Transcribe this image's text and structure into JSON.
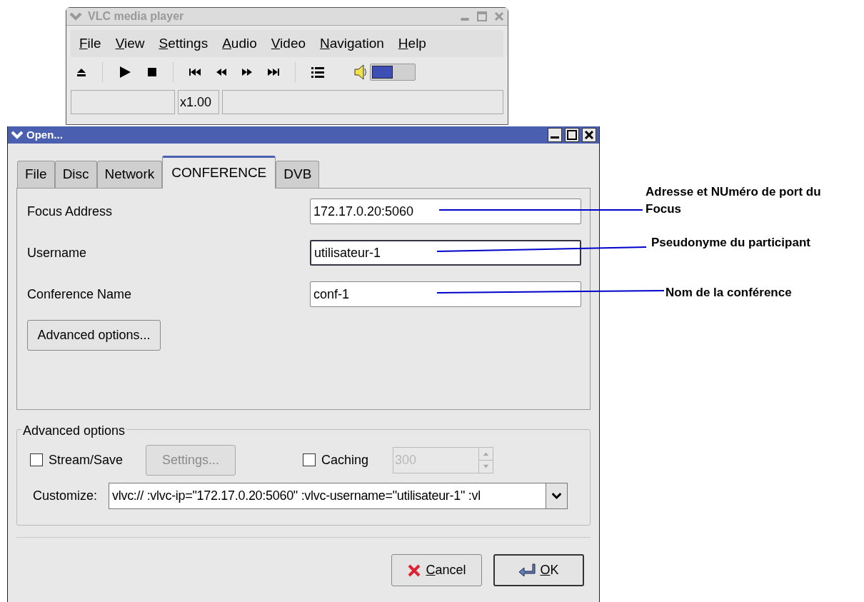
{
  "vlc_window": {
    "title": "VLC media player",
    "menu": [
      "File",
      "View",
      "Settings",
      "Audio",
      "Video",
      "Navigation",
      "Help"
    ],
    "volume": {
      "level": 0.5
    },
    "status_bar": {
      "speed": "x1.00"
    }
  },
  "open_dialog": {
    "title": "Open...",
    "tabs": [
      {
        "label": "File",
        "selected": false
      },
      {
        "label": "Disc",
        "selected": false
      },
      {
        "label": "Network",
        "selected": false
      },
      {
        "label": "CONFERENCE",
        "selected": true
      },
      {
        "label": "DVB",
        "selected": false
      }
    ],
    "fields": [
      {
        "label": "Focus Address",
        "value": "172.17.0.20:5060",
        "focused": false
      },
      {
        "label": "Username",
        "value": "utilisateur-1",
        "focused": true
      },
      {
        "label": "Conference Name",
        "value": "conf-1",
        "focused": false
      }
    ],
    "advanced_button": "Advanced options...",
    "advanced_options": {
      "title": "Advanced options",
      "stream_save": {
        "label": "Stream/Save",
        "checked": false
      },
      "settings_button": {
        "label": "Settings...",
        "disabled": true
      },
      "caching": {
        "label": "Caching",
        "checked": false,
        "value": "300",
        "disabled": true
      },
      "customize": {
        "label": "Customize:",
        "value": "vlvc:// :vlvc-ip=\"172.17.0.20:5060\" :vlvc-username=\"utilisateur-1\" :vl"
      }
    },
    "buttons": [
      {
        "label": "Cancel",
        "kind": "cancel"
      },
      {
        "label": "OK",
        "kind": "ok"
      }
    ]
  },
  "annotations": [
    {
      "text": "Adresse et NUméro de port du Focus"
    },
    {
      "text": "Pseudonyme du participant"
    },
    {
      "text": "Nom de la conférence"
    }
  ]
}
